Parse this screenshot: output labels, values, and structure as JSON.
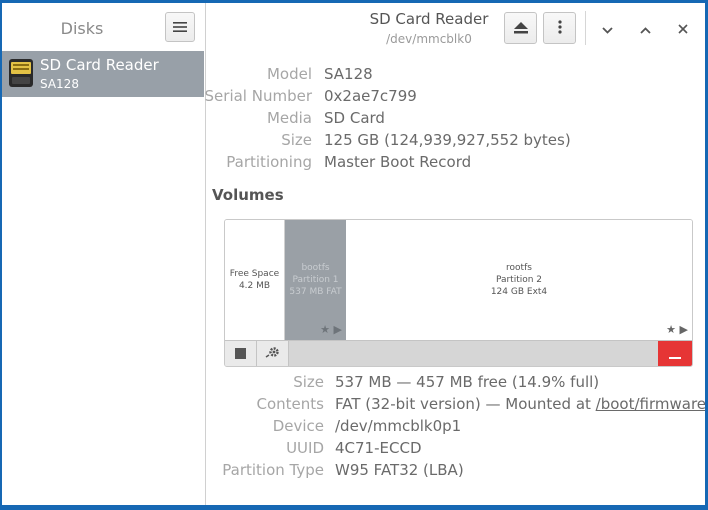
{
  "sidebar": {
    "title": "Disks",
    "disks": [
      {
        "name": "SD Card Reader",
        "model": "SA128"
      }
    ]
  },
  "header": {
    "title": "SD Card Reader",
    "subtitle": "/dev/mmcblk0"
  },
  "drive_info": [
    {
      "label": "Model",
      "value": "SA128"
    },
    {
      "label": "Serial Number",
      "value": "0x2ae7c799"
    },
    {
      "label": "Media",
      "value": "SD Card"
    },
    {
      "label": "Size",
      "value": "125 GB (124,939,927,552 bytes)"
    },
    {
      "label": "Partitioning",
      "value": "Master Boot Record"
    }
  ],
  "volumes": {
    "title": "Volumes",
    "segments": [
      {
        "line1": "Free Space",
        "line2": "4.2 MB"
      },
      {
        "line1": "bootfs",
        "line2": "Partition 1",
        "line3": "537 MB FAT"
      },
      {
        "line1": "rootfs",
        "line2": "Partition 2",
        "line3": "124 GB Ext4"
      }
    ]
  },
  "partition_info": {
    "size_label": "Size",
    "size_value": "537 MB — 457 MB free (14.9% full)",
    "contents_label": "Contents",
    "contents_value": "FAT (32-bit version) — Mounted at ",
    "contents_link": "/boot/firmware",
    "device_label": "Device",
    "device_value": "/dev/mmcblk0p1",
    "uuid_label": "UUID",
    "uuid_value": "4C71-ECCD",
    "type_label": "Partition Type",
    "type_value": "W95 FAT32 (LBA)"
  },
  "colors": {
    "desktop": "#1668b4",
    "selection": "#98a0a8",
    "danger": "#e63535"
  },
  "icons": [
    "menu-icon",
    "sd-card-icon",
    "eject-icon",
    "more-vert-icon",
    "chevron-down-icon",
    "chevron-up-icon",
    "close-icon",
    "star-icon",
    "play-icon",
    "stop-icon",
    "gear-icon",
    "minus-icon"
  ]
}
